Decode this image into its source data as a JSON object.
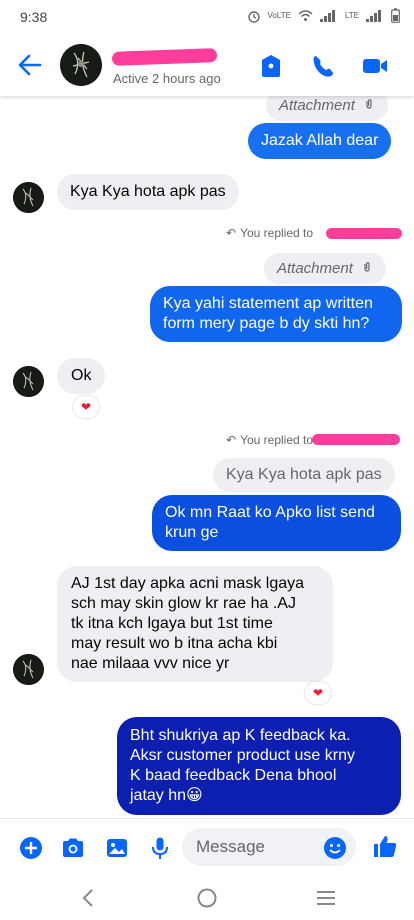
{
  "status_bar": {
    "time": "9:38",
    "wifi_text": "VoLTE",
    "net_text": "LTE"
  },
  "header": {
    "active_status": "Active 2 hours ago"
  },
  "messages": {
    "attachment_top": "Attachment",
    "out_jazak": "Jazak Allah dear",
    "in_kya": "Kya Kya hota apk pas",
    "replied_to_1": "You replied to",
    "attachment_mid": "Attachment",
    "out_statement_line1": "Kya yahi statement ap written",
    "out_statement_line2": "form mery page b dy skti hn?",
    "in_ok": "Ok",
    "replied_to_2": "You replied to",
    "quoted_kya": "Kya Kya hota apk pas",
    "out_list_line1": "Ok mn Raat ko Apko list send",
    "out_list_line2": "krun ge",
    "in_long_line1": "AJ 1st day apka acni mask lgaya",
    "in_long_line2": "sch may skin glow kr rae ha .AJ",
    "in_long_line3": "tk itna kch lgaya but 1st time",
    "in_long_line4": "may result wo b itna acha kbi",
    "in_long_line5": "nae milaaa vvv nice yr",
    "out_thanks_line1": "Bht shukriya ap K feedback ka.",
    "out_thanks_line2": "Aksr customer product use krny",
    "out_thanks_line3": "K baad feedback Dena bhool",
    "out_thanks_line4": "jatay hn😀"
  },
  "composer": {
    "placeholder": "Message"
  },
  "colors": {
    "accent": "#0866ff",
    "bubble_out_top": "#1877f2",
    "bubble_out_bottom": "#0a1fb5",
    "bubble_in": "#eeeff2",
    "heart": "#e41e3f"
  }
}
